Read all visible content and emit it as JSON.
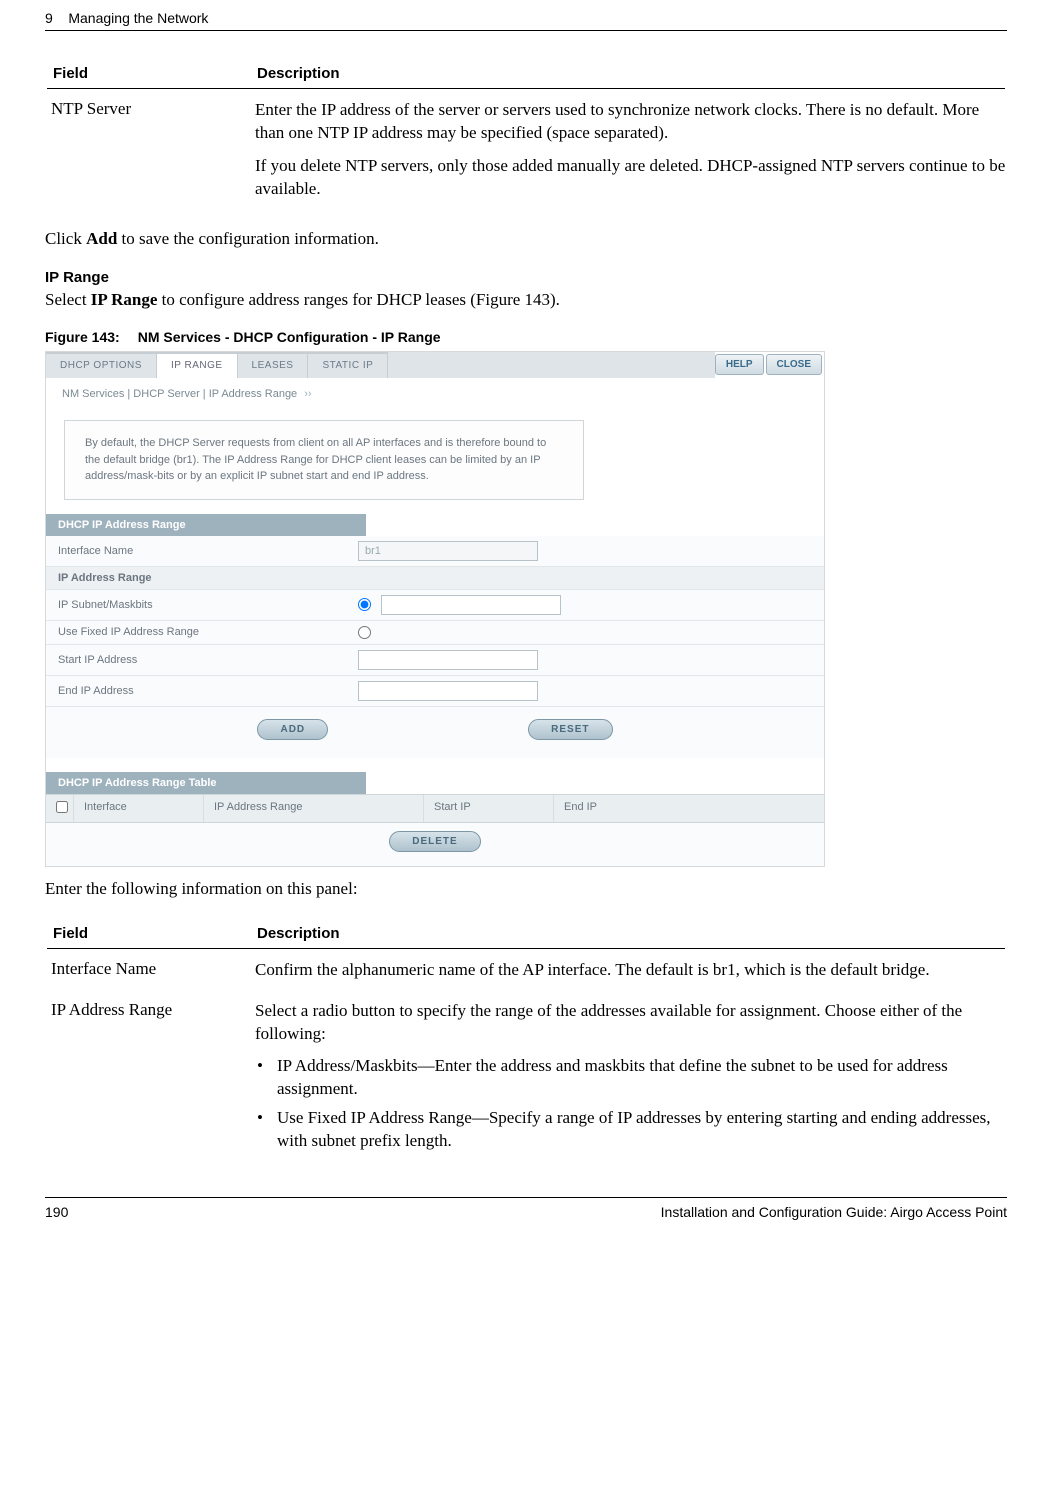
{
  "header": {
    "section_number": "9",
    "section_title": "Managing the Network"
  },
  "table1": {
    "head_field": "Field",
    "head_desc": "Description",
    "rows": [
      {
        "field": "NTP Server",
        "desc_p1": "Enter the IP address of the server or servers used to synchronize network clocks. There is no default. More than one NTP IP address may be specified (space separated).",
        "desc_p2": "If you delete NTP servers, only those added manually are deleted. DHCP-assigned NTP servers continue to be available."
      }
    ]
  },
  "body": {
    "p1_pre": "Click ",
    "p1_bold": "Add",
    "p1_post": " to save the configuration information.",
    "sub_iprange": "IP Range",
    "p2_pre": "Select ",
    "p2_bold": "IP Range",
    "p2_post": " to configure address ranges for DHCP leases (Figure 143).",
    "fig_num": "Figure 143:",
    "fig_title": "NM Services - DHCP Configuration - IP Range",
    "p3": "Enter the following information on this panel:"
  },
  "screenshot": {
    "tabs": {
      "dhcp": "DHCP OPTIONS",
      "iprange": "IP RANGE",
      "leases": "LEASES",
      "staticip": "STATIC IP"
    },
    "help": "HELP",
    "close": "CLOSE",
    "breadcrumb": "NM Services | DHCP Server | IP Address Range",
    "arrows": "››",
    "intro": "By default, the DHCP Server requests from client on all AP interfaces and is therefore bound to the default bridge (br1). The IP Address Range for DHCP client leases can be limited by an IP address/mask-bits or by an explicit IP subnet start and end IP address.",
    "sec1": "DHCP IP Address Range",
    "row_iface": "Interface Name",
    "iface_val": "br1",
    "sub_iprange": "IP Address Range",
    "row_subnet": "IP Subnet/Maskbits",
    "row_fixed": "Use Fixed IP Address Range",
    "row_start": "Start IP Address",
    "row_end": "End IP Address",
    "btn_add": "ADD",
    "btn_reset": "RESET",
    "sec2": "DHCP IP Address Range Table",
    "th_iface": "Interface",
    "th_range": "IP Address Range",
    "th_start": "Start IP",
    "th_end": "End IP",
    "btn_delete": "DELETE"
  },
  "table2": {
    "head_field": "Field",
    "head_desc": "Description",
    "row1": {
      "field": "Interface Name",
      "desc": "Confirm the alphanumeric name of the AP interface. The default is br1, which is the default bridge."
    },
    "row2": {
      "field": "IP Address Range",
      "desc": "Select a radio button to specify the range of the addresses available for assignment. Choose either of the following:",
      "b1": "IP Address/Maskbits—Enter the address and maskbits that define the subnet to be used for address assignment.",
      "b2": "Use Fixed IP Address Range—Specify a range of IP addresses by entering starting and ending addresses, with subnet prefix length."
    }
  },
  "footer": {
    "page": "190",
    "doc": "Installation and Configuration Guide: Airgo Access Point"
  }
}
